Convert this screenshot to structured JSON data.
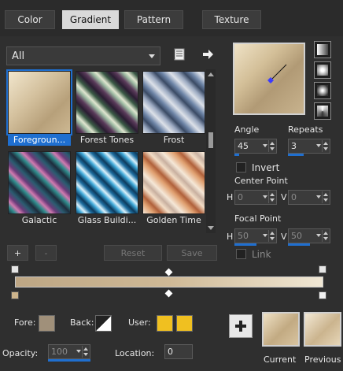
{
  "tabs": [
    {
      "label": "Color"
    },
    {
      "label": "Gradient"
    },
    {
      "label": "Pattern"
    },
    {
      "label": "Texture"
    }
  ],
  "category": {
    "selected": "All"
  },
  "presets": [
    {
      "label": "Foregroun...",
      "selected": true
    },
    {
      "label": "Forest Tones"
    },
    {
      "label": "Frost"
    },
    {
      "label": "Galactic"
    },
    {
      "label": "Glass Buildi..."
    },
    {
      "label": "Golden Time"
    }
  ],
  "preset_buttons": {
    "add": "+",
    "remove": "-",
    "reset": "Reset",
    "save": "Save"
  },
  "angle": {
    "label": "Angle",
    "value": "45"
  },
  "repeats": {
    "label": "Repeats",
    "value": "3"
  },
  "invert": {
    "label": "Invert"
  },
  "center_point": {
    "label": "Center Point",
    "h_label": "H",
    "h_value": "0",
    "v_label": "V",
    "v_value": "0"
  },
  "focal_point": {
    "label": "Focal Point",
    "h_label": "H",
    "h_value": "50",
    "v_label": "V",
    "v_value": "50"
  },
  "link": {
    "label": "Link"
  },
  "bottom": {
    "fore_label": "Fore:",
    "back_label": "Back:",
    "user_label": "User:",
    "opacity_label": "Opacity:",
    "opacity_value": "100",
    "location_label": "Location:",
    "location_value": "0",
    "current_label": "Current",
    "previous_label": "Previous"
  },
  "colors": {
    "accent": "#1f6fd0",
    "gradient_start": "#bda684",
    "gradient_end": "#f0e7d4",
    "user_swatch": "#f0c020"
  }
}
